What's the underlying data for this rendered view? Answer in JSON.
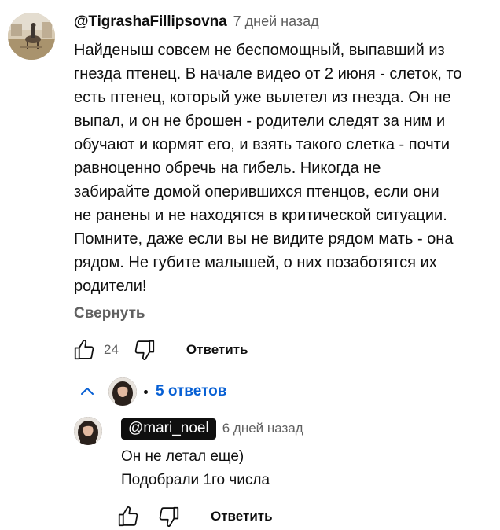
{
  "comment": {
    "author": "@TigrashaFillipsovna",
    "timestamp": "7 дней назад",
    "lines": [
      "Найденыш совсем не беспомощный, выпавший из",
      "гнезда птенец. В начале видео от 2 июня - слеток, то",
      "есть птенец, который уже вылетел из гнезда. Он не",
      "выпал, и он не брошен - родители следят за ним и",
      "обучают и кормят его, и взять такого слетка - почти",
      "равноценно обречь на гибель. Никогда не",
      "забирайте домой оперившихся птенцов, если они",
      "не ранены и не находятся в критической ситуации.",
      "Помните, даже если вы не видите рядом мать - она",
      "рядом. Не губите малышей, о них позаботятся их",
      "родители!"
    ],
    "collapse_label": "Свернуть",
    "like_count": "24",
    "reply_label": "Ответить",
    "like_icon": "thumb-up-icon",
    "dislike_icon": "thumb-down-icon"
  },
  "replies_toggle": {
    "label": "5 ответов",
    "icon": "chevron-up-icon",
    "accent_color": "#065fd4"
  },
  "reply": {
    "author": "@mari_noel",
    "timestamp": "6 дней назад",
    "lines": [
      "Он не летал еще)",
      "Подобрали 1го числа"
    ],
    "reply_label": "Ответить"
  }
}
